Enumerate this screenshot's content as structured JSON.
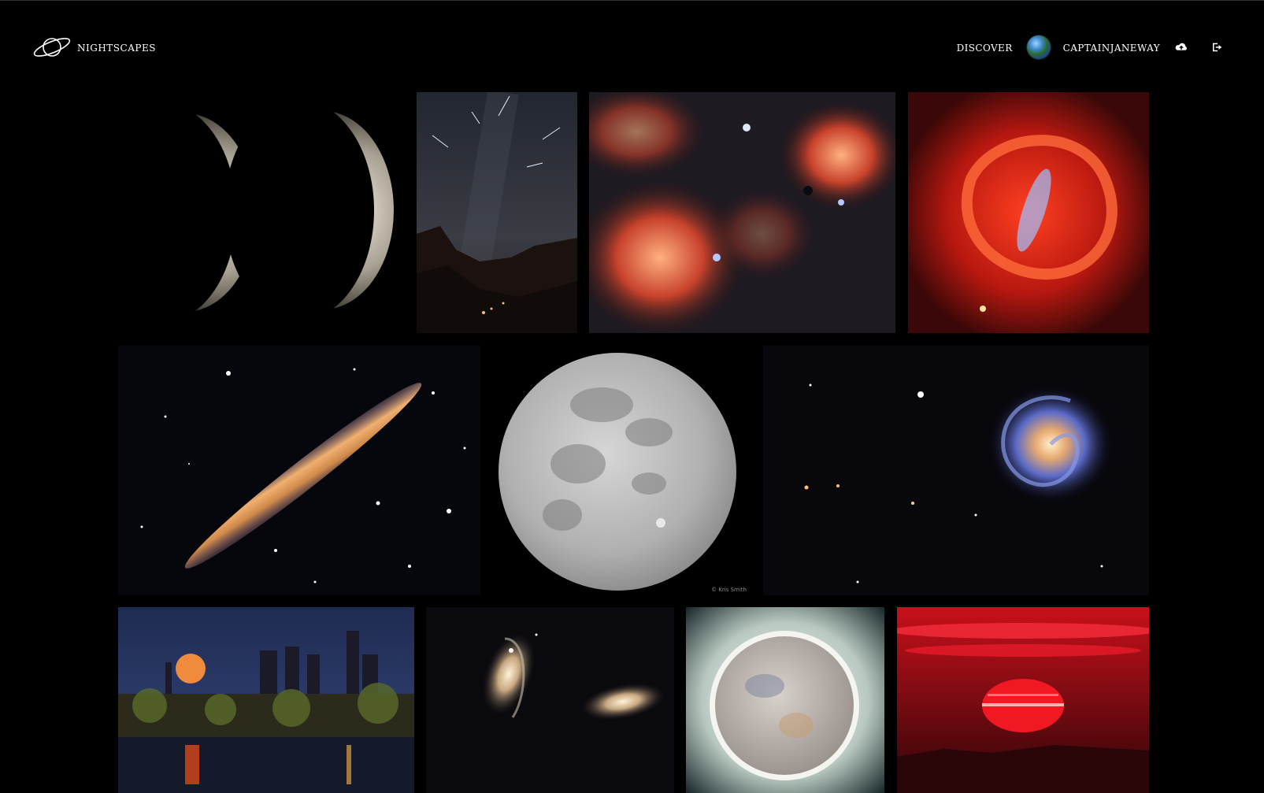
{
  "app": {
    "brand": "Nightscapes",
    "icon": "saturn-ring-icon"
  },
  "nav": {
    "discover": "Discover",
    "username": "CaptainJaneway",
    "avatar": "earth-avatar",
    "upload_icon": "cloud-upload-icon",
    "logout_icon": "sign-out-icon"
  },
  "photos": [
    {
      "subject": "jupiter-crescents"
    },
    {
      "subject": "meteor-shower-valley"
    },
    {
      "subject": "red-emission-nebula-field"
    },
    {
      "subject": "squid-nebula"
    },
    {
      "subject": "edge-on-galaxy"
    },
    {
      "subject": "full-moon-transit",
      "credit": "© Kris Smith"
    },
    {
      "subject": "pinwheel-galaxy"
    },
    {
      "subject": "moonrise-city-skyline"
    },
    {
      "subject": "interacting-galaxies"
    },
    {
      "subject": "full-moon-halo"
    },
    {
      "subject": "red-sunset-sun"
    }
  ],
  "colors": {
    "background": "#000000",
    "text": "#ffffff"
  }
}
